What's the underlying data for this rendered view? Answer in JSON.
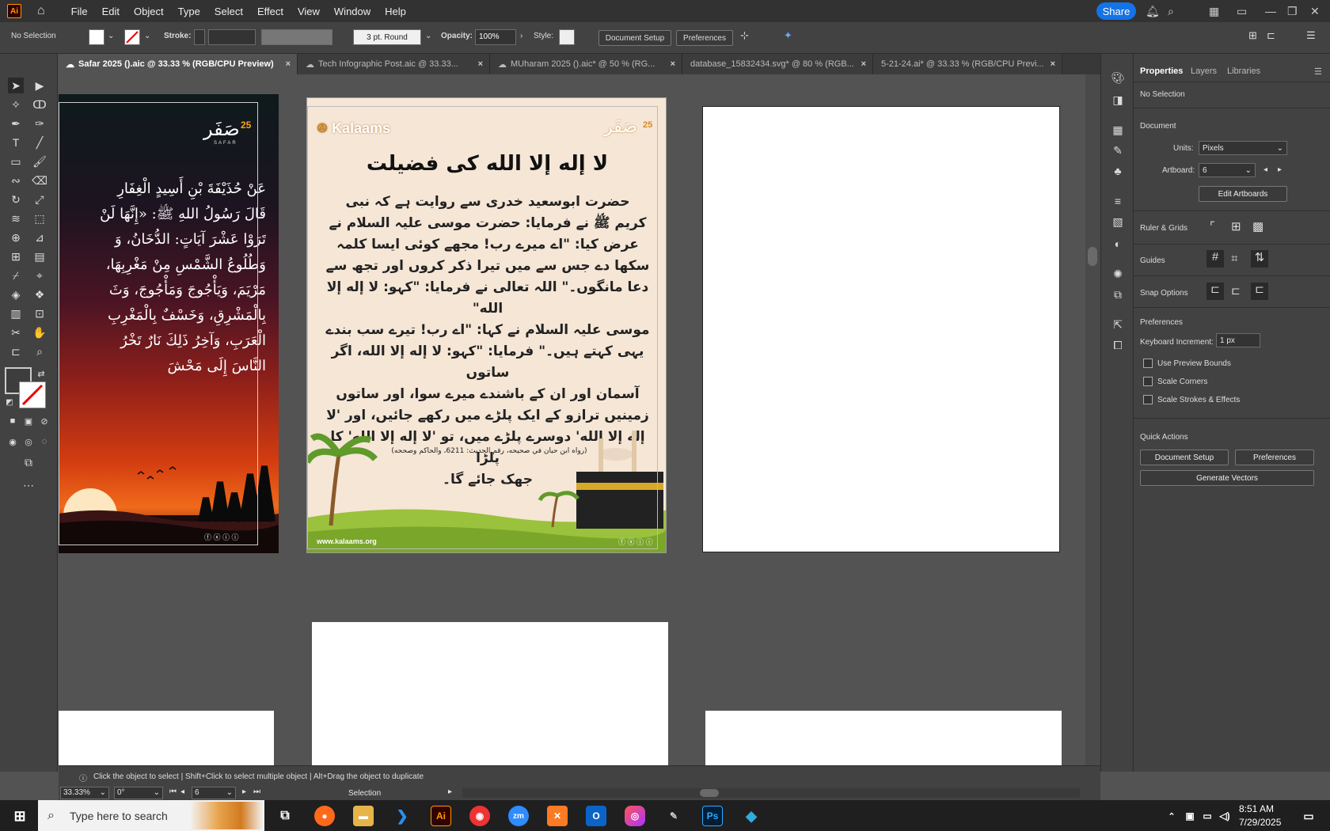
{
  "menubar": {
    "logo": "Ai",
    "items": [
      "File",
      "Edit",
      "Object",
      "Type",
      "Select",
      "Effect",
      "View",
      "Window",
      "Help"
    ],
    "share_label": "Share"
  },
  "control": {
    "selection": "No Selection",
    "stroke_label": "Stroke:",
    "brush": "3 pt. Round",
    "opacity_label": "Opacity:",
    "opacity_value": "100%",
    "style_label": "Style:",
    "doc_setup": "Document Setup",
    "preferences": "Preferences"
  },
  "tabs": [
    {
      "label": "Safar 2025 ().aic @ 33.33 % (RGB/CPU Preview)",
      "active": true
    },
    {
      "label": "Tech Infographic Post.aic @ 33.33..."
    },
    {
      "label": "MUharam 2025 ().aic* @ 50 % (RG..."
    },
    {
      "label": "database_15832434.svg* @ 80 % (RGB..."
    },
    {
      "label": "5-21-24.ai* @ 33.33 % (RGB/CPU Previ..."
    }
  ],
  "artwork1": {
    "logo_text": "صَفَر",
    "logo_sub": "SAFAR",
    "logo_num": "25",
    "lines": [
      "عَنْ حُذَيْفَةَ بْنِ أَسِيدٍ الْغِفَارِ",
      "قَالَ رَسُولُ اللهِ ﷺ: «إِنَّهَا لَنْ",
      "تَرَوْا عَشْرَ آيَاتٍ: الدُّخَانُ، وَ",
      "وَطُلُوعُ الشَّمْسِ مِنْ مَغْرِبِهَا،",
      "مَرْيَمَ، وَيَأْجُوجَ وَمَأْجُوجَ، وَثَ",
      "بِالْمَشْرِقِ، وَخَسْفٌ بِالْمَغْرِبِ",
      "الْعَرَبِ، وَآخِرُ ذَلِكَ نَارٌ تَخْرُ",
      "النَّاسَ إِلَى مَحْشَ"
    ]
  },
  "artwork2": {
    "brand": "Kalaams",
    "logo_text": "صَفَر",
    "logo_num": "25",
    "title": "لا إله إلا الله کی فضیلت",
    "body_lines": [
      "حضرت ابوسعید خدری سے روایت ہے کہ نبی",
      "کریم ﷺ نے فرمایا: حضرت موسی علیہ السلام نے",
      "عرض کیا: \"اے میرے رب! مجھے کوئی ایسا کلمہ",
      "سکھا دے جس سے میں تیرا ذکر کروں اور تجھ سے",
      "دعا مانگوں۔\" اللہ تعالی نے فرمایا: \"کہو: لا إله إلا الله\"",
      "موسی علیہ السلام نے کہا: \"اے رب! تیرے سب بندے",
      "یہی کہتے ہیں۔\" فرمایا: \"کہو: لا إله إلا الله، اگر ساتوں",
      "آسمان اور ان کے باشندے میرے سوا، اور ساتوں",
      "زمینیں ترازو کے ایک پلڑے میں رکھے جائیں، اور 'لا",
      "إله إلا الله' دوسرے پلڑے میں، تو 'لا إله إلا الله' کا پلڑا",
      "جھک جائے گا۔"
    ],
    "reference": "(رواه ابن حبان في صحيحه، رقم الحديث: 6211، والحاكم وصححه)",
    "website": "www.kalaams.org"
  },
  "properties": {
    "tabs": [
      "Properties",
      "Layers",
      "Libraries"
    ],
    "no_selection": "No Selection",
    "document": "Document",
    "units_label": "Units:",
    "units_value": "Pixels",
    "artboard_label": "Artboard:",
    "artboard_value": "6",
    "edit_artboards": "Edit Artboards",
    "ruler_grids": "Ruler & Grids",
    "guides": "Guides",
    "snap_options": "Snap Options",
    "preferences": "Preferences",
    "keyboard_increment_label": "Keyboard Increment:",
    "keyboard_increment_value": "1 px",
    "use_preview_bounds": "Use Preview Bounds",
    "scale_corners": "Scale Corners",
    "scale_strokes": "Scale Strokes & Effects",
    "quick_actions": "Quick Actions",
    "qa_doc_setup": "Document Setup",
    "qa_preferences": "Preferences",
    "generate_vectors": "Generate Vectors"
  },
  "status": {
    "hint": "Click the object to select  |  Shift+Click to select multiple object  |  Alt+Drag the object to duplicate",
    "zoom": "33.33%",
    "rotate": "0°",
    "artboard": "6",
    "mode": "Selection"
  },
  "taskbar": {
    "search_placeholder": "Type here to search",
    "time": "8:51 AM",
    "date": "7/29/2025"
  }
}
